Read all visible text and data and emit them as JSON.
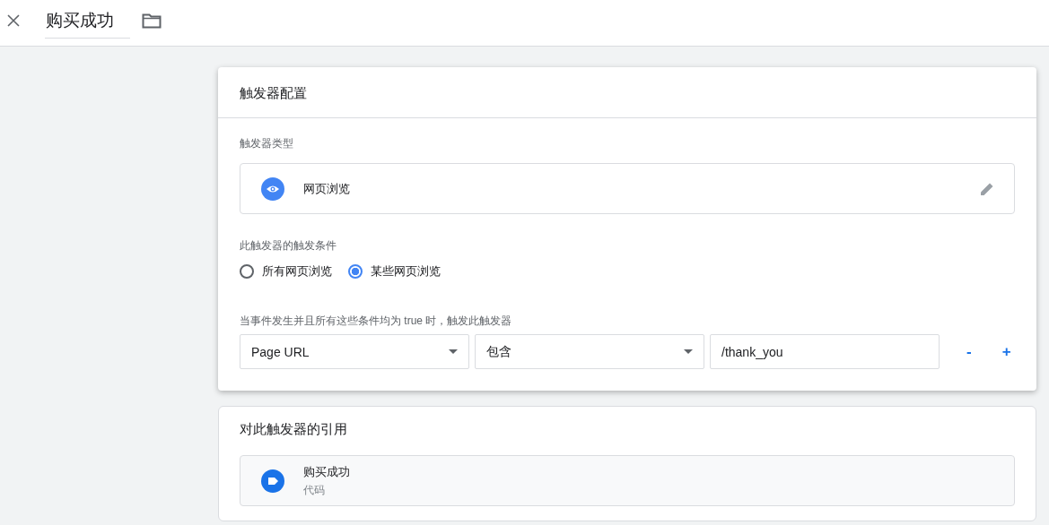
{
  "header": {
    "name": "购买成功"
  },
  "config": {
    "title": "触发器配置",
    "type_label": "触发器类型",
    "type": {
      "name": "网页浏览"
    },
    "condition_label": "此触发器的触发条件",
    "options": [
      {
        "label": "所有网页浏览",
        "selected": false
      },
      {
        "label": "某些网页浏览",
        "selected": true
      }
    ],
    "filter_label": "当事件发生并且所有这些条件均为 true 时，触发此触发器",
    "filter": {
      "variable": "Page URL",
      "operator": "包含",
      "value": "/thank_you",
      "remove": "-",
      "add": "+"
    }
  },
  "references": {
    "title": "对此触发器的引用",
    "items": [
      {
        "name": "购买成功",
        "kind_label": "代码"
      }
    ]
  }
}
